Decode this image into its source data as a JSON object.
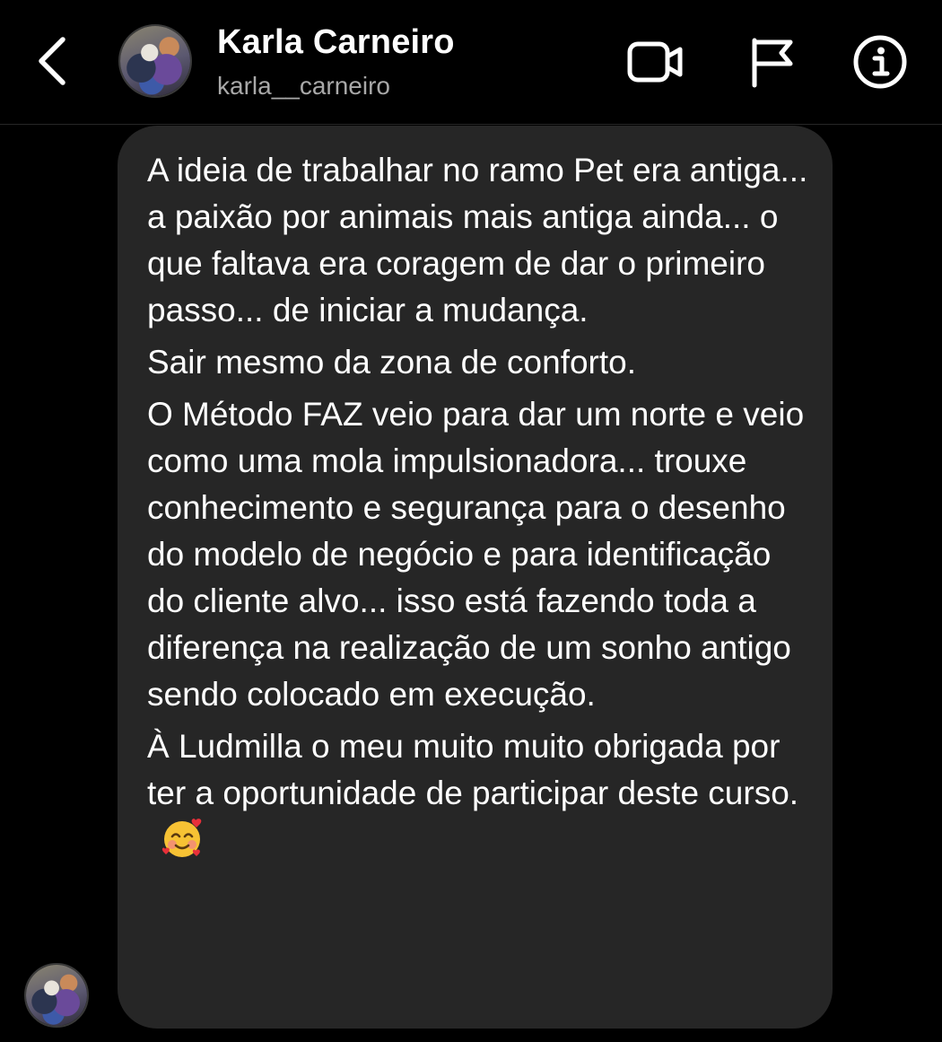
{
  "header": {
    "name": "Karla Carneiro",
    "username": "karla__carneiro",
    "icons": {
      "back": "chevron-left-icon",
      "video": "video-camera-icon",
      "flag": "flag-icon",
      "info": "info-icon"
    }
  },
  "message": {
    "lines": [
      "A ideia de trabalhar no ramo Pet era antiga... a paixão por animais mais antiga ainda... o que faltava era coragem de dar o primeiro passo... de iniciar a mudança.",
      "Sair mesmo da zona de conforto.",
      "O Método FAZ veio para dar um norte e veio como uma mola impulsionadora... trouxe conhecimento e segurança para o desenho do modelo de negócio e para identificação do cliente alvo... isso está fazendo toda a diferença na realização de um sonho antigo sendo colocado em execução.",
      "À Ludmilla o meu muito muito obrigada por ter a oportunidade de participar deste curso."
    ],
    "emoji": "smiling-face-with-hearts-icon"
  },
  "colors": {
    "background": "#000000",
    "bubble": "#262626",
    "text": "#ffffff",
    "secondary_text": "#a8a8a8"
  }
}
